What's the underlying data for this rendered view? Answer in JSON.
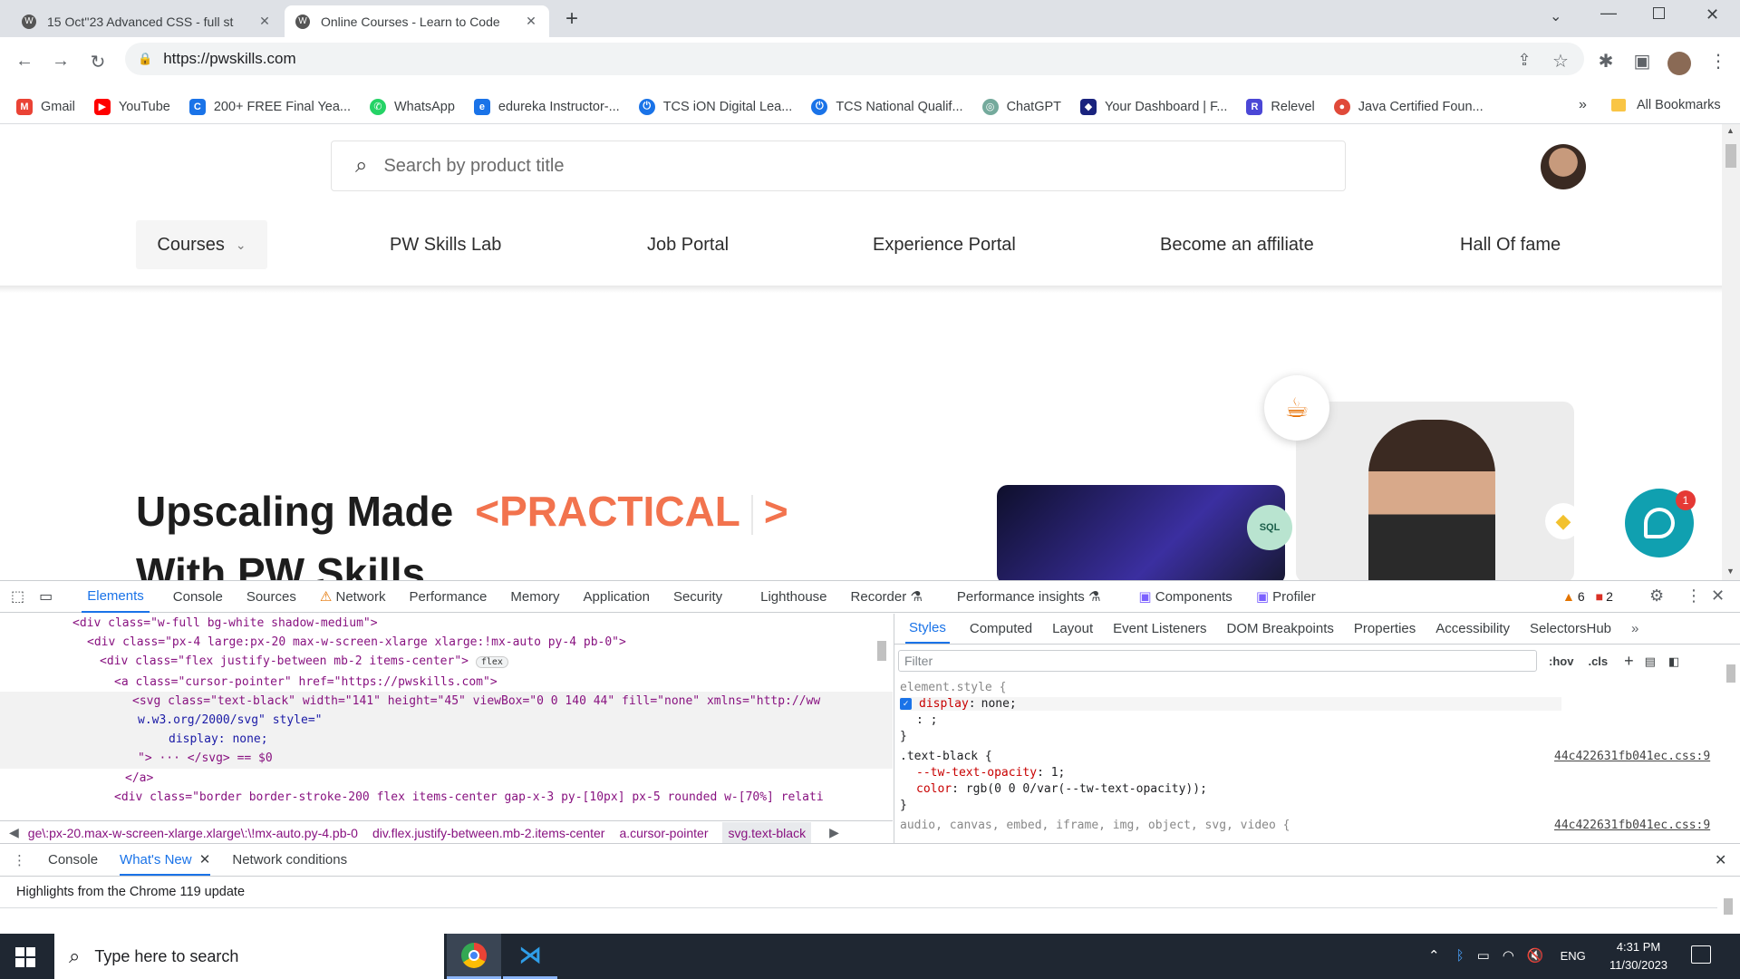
{
  "tabs": [
    {
      "title": "15 Oct''23 Advanced CSS - full st",
      "icon": "wordpress-icon"
    },
    {
      "title": "Online Courses - Learn to Code",
      "icon": "wordpress-icon"
    }
  ],
  "address": {
    "url": "https://pwskills.com"
  },
  "bookmarks": [
    {
      "label": "Gmail",
      "color": "#ea4335",
      "glyph": "M"
    },
    {
      "label": "YouTube",
      "color": "#ff0000",
      "glyph": "▶"
    },
    {
      "label": "200+ FREE Final Yea...",
      "color": "#1a73e8",
      "glyph": "C"
    },
    {
      "label": "WhatsApp",
      "color": "#25d366",
      "glyph": "✆"
    },
    {
      "label": "edureka Instructor-...",
      "color": "#1a73e8",
      "glyph": "e"
    },
    {
      "label": "TCS iON Digital Lea...",
      "color": "#1a73e8",
      "glyph": "⏻"
    },
    {
      "label": "TCS National Qualif...",
      "color": "#1a73e8",
      "glyph": "⏻"
    },
    {
      "label": "ChatGPT",
      "color": "#74aa9c",
      "glyph": "◎"
    },
    {
      "label": "Your Dashboard | F...",
      "color": "#1a237e",
      "glyph": "◆"
    },
    {
      "label": "Relevel",
      "color": "#4b47d6",
      "glyph": "R"
    },
    {
      "label": "Java Certified Foun...",
      "color": "#e04a3a",
      "glyph": "●"
    }
  ],
  "all_bookmarks": "All Bookmarks",
  "page": {
    "search_placeholder": "Search by product title",
    "nav": [
      "Courses",
      "PW Skills Lab",
      "Job Portal",
      "Experience Portal",
      "Become an affiliate",
      "Hall Of fame"
    ],
    "hero_line1": "Upscaling Made",
    "hero_highlight": "<PRACTICAL",
    "hero_close": ">",
    "hero_line2": "With PW Skills",
    "chat_badge": "1"
  },
  "devtools": {
    "tabs": [
      "Elements",
      "Console",
      "Sources",
      "Network",
      "Performance",
      "Memory",
      "Application",
      "Security",
      "Lighthouse",
      "Recorder",
      "Performance insights",
      "Components",
      "Profiler"
    ],
    "warn_count": "6",
    "error_count": "2",
    "dom": [
      "<div class=\"w-full bg-white shadow-medium\">",
      "<div class=\"px-4 large:px-20 max-w-screen-xlarge xlarge:!mx-auto py-4 pb-0\">",
      "<div class=\"flex justify-between mb-2 items-center\">",
      "<a class=\"cursor-pointer\" href=\"https://pwskills.com\">",
      "<svg class=\"text-black\" width=\"141\" height=\"45\" viewBox=\"0 0 140 44\" fill=\"none\" xmlns=\"http://ww",
      "w.w3.org/2000/svg\" style=\"",
      "display: none;",
      "\"> ··· </svg> == $0",
      "</a>",
      "<div class=\"border border-stroke-200 flex items-center gap-x-3 py-[10px] px-5 rounded w-[70%] relati"
    ],
    "flex_badge": "flex",
    "breadcrumbs": [
      "ge\\:px-20.max-w-screen-xlarge.xlarge\\:\\!mx-auto.py-4.pb-0",
      "div.flex.justify-between.mb-2.items-center",
      "a.cursor-pointer",
      "svg.text-black"
    ],
    "styles_tabs": [
      "Styles",
      "Computed",
      "Layout",
      "Event Listeners",
      "DOM Breakpoints",
      "Properties",
      "Accessibility",
      "SelectorsHub"
    ],
    "filter_placeholder": "Filter",
    "hov": ":hov",
    "cls": ".cls",
    "css": {
      "element_style": "element.style {",
      "prop1": "display",
      "val1": "none;",
      "rule2": ".text-black {",
      "source2": "44c422631fb041ec.css:9",
      "prop2a": "--tw-text-opacity",
      "val2a": "1;",
      "prop2b": "color",
      "val2b": "rgb(0 0 0/var(--tw-text-opacity));",
      "rule3": "audio, canvas, embed, iframe, img, object, svg, video {",
      "source3": "44c422631fb041ec.css:9"
    }
  },
  "drawer": {
    "tabs": [
      "Console",
      "What's New",
      "Network conditions"
    ],
    "highlight": "Highlights from the Chrome 119 update"
  },
  "taskbar": {
    "search_placeholder": "Type here to search",
    "lang": "ENG",
    "time": "4:31 PM",
    "date": "11/30/2023"
  }
}
